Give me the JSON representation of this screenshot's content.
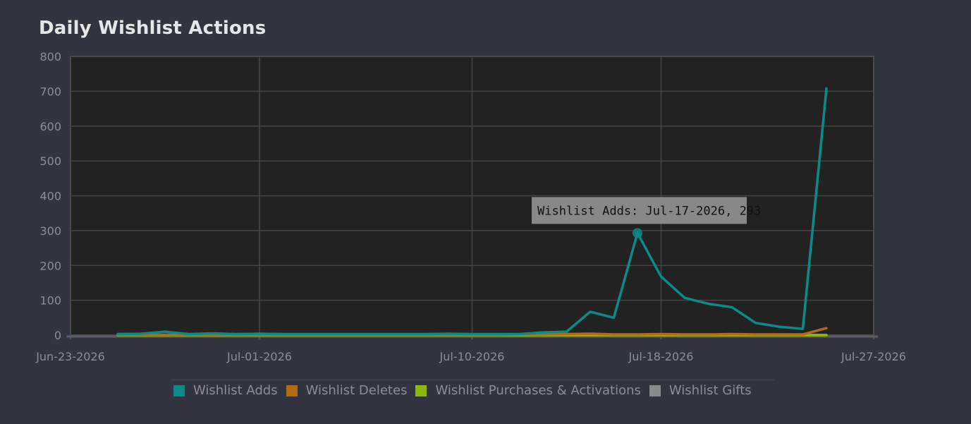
{
  "title": "Daily Wishlist Actions",
  "colors": {
    "background": "#32353f",
    "plot_background": "#222222",
    "grid": "#444444",
    "adds": "#0b8a88",
    "deletes": "#b16c12",
    "purchases": "#8fb80c",
    "gifts": "#8a8a8a"
  },
  "tooltip": {
    "text": "Wishlist Adds: Jul-17-2026, 293"
  },
  "chart_data": {
    "type": "line",
    "title": "Daily Wishlist Actions",
    "xlabel": "",
    "ylabel": "",
    "ylim": [
      0,
      800
    ],
    "yticks": [
      0,
      100,
      200,
      300,
      400,
      500,
      600,
      700,
      800
    ],
    "xlim": [
      "2026-06-23",
      "2026-07-27"
    ],
    "xticks": [
      {
        "date": "2026-06-23",
        "label": "Jun-23-2026"
      },
      {
        "date": "2026-07-01",
        "label": "Jul-01-2026"
      },
      {
        "date": "2026-07-10",
        "label": "Jul-10-2026"
      },
      {
        "date": "2026-07-18",
        "label": "Jul-18-2026"
      },
      {
        "date": "2026-07-27",
        "label": "Jul-27-2026"
      }
    ],
    "grid": true,
    "legend_position": "bottom",
    "x": [
      "2026-06-25",
      "2026-06-26",
      "2026-06-27",
      "2026-06-28",
      "2026-06-29",
      "2026-06-30",
      "2026-07-01",
      "2026-07-02",
      "2026-07-03",
      "2026-07-04",
      "2026-07-05",
      "2026-07-06",
      "2026-07-07",
      "2026-07-08",
      "2026-07-09",
      "2026-07-10",
      "2026-07-11",
      "2026-07-12",
      "2026-07-13",
      "2026-07-14",
      "2026-07-15",
      "2026-07-16",
      "2026-07-17",
      "2026-07-18",
      "2026-07-19",
      "2026-07-20",
      "2026-07-21",
      "2026-07-22",
      "2026-07-23",
      "2026-07-24",
      "2026-07-25"
    ],
    "series": [
      {
        "name": "Wishlist Adds",
        "color": "#0b8a88",
        "values": [
          3,
          4,
          10,
          3,
          5,
          3,
          4,
          3,
          3,
          3,
          3,
          3,
          3,
          3,
          4,
          3,
          3,
          3,
          8,
          10,
          67,
          50,
          293,
          168,
          107,
          90,
          80,
          35,
          24,
          18,
          708
        ]
      },
      {
        "name": "Wishlist Deletes",
        "color": "#b16c12",
        "values": [
          1,
          1,
          1,
          1,
          1,
          1,
          1,
          1,
          1,
          1,
          1,
          1,
          1,
          1,
          1,
          1,
          1,
          2,
          2,
          3,
          4,
          2,
          2,
          3,
          2,
          2,
          3,
          2,
          2,
          2,
          20
        ]
      },
      {
        "name": "Wishlist Purchases & Activations",
        "color": "#8fb80c",
        "values": [
          0,
          0,
          0,
          0,
          0,
          0,
          0,
          0,
          0,
          0,
          0,
          0,
          0,
          0,
          0,
          0,
          0,
          0,
          0,
          0,
          0,
          0,
          0,
          0,
          0,
          0,
          0,
          0,
          0,
          0,
          0
        ]
      },
      {
        "name": "Wishlist Gifts",
        "color": "#8a8a8a",
        "values": [
          0,
          0,
          0,
          0,
          0,
          0,
          0,
          0,
          0,
          0,
          0,
          0,
          0,
          0,
          0,
          0,
          0,
          0,
          0,
          0,
          0,
          0,
          0,
          0,
          0,
          0,
          0,
          0,
          0,
          0,
          0
        ]
      }
    ],
    "highlight": {
      "series": "Wishlist Adds",
      "date": "2026-07-17",
      "value": 293
    }
  }
}
